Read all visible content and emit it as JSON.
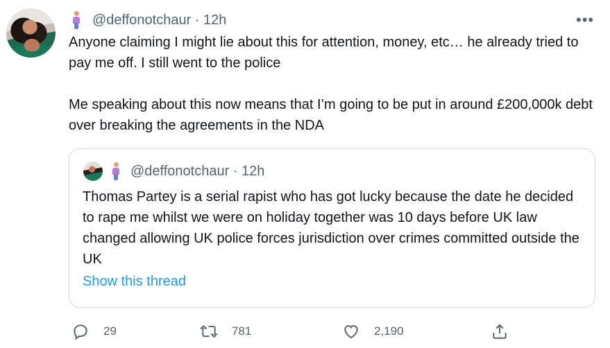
{
  "tweet": {
    "handle": "@deffonotchaur",
    "separator": " · ",
    "time": "12h",
    "more": "•••",
    "text": "Anyone claiming I might lie about this for attention, money, etc… he already tried to pay me off. I still went to the police\n\nMe speaking about this now means that I’m going to be put in around £200,000k debt over breaking the agreements in the NDA"
  },
  "quoted": {
    "handle": "@deffonotchaur",
    "separator": " · ",
    "time": "12h",
    "text": "Thomas Partey is a serial rapist who has got lucky because the date he decided to rape me whilst we were on holiday together was 10 days before UK law changed allowing UK police forces jurisdiction over crimes committed outside the UK",
    "show_thread": "Show this thread"
  },
  "actions": {
    "replies": "29",
    "retweets": "781",
    "likes": "2,190"
  },
  "colors": {
    "text": "#0f1419",
    "secondary": "#536471",
    "link": "#1d9bf0",
    "border": "#cfd9de"
  }
}
